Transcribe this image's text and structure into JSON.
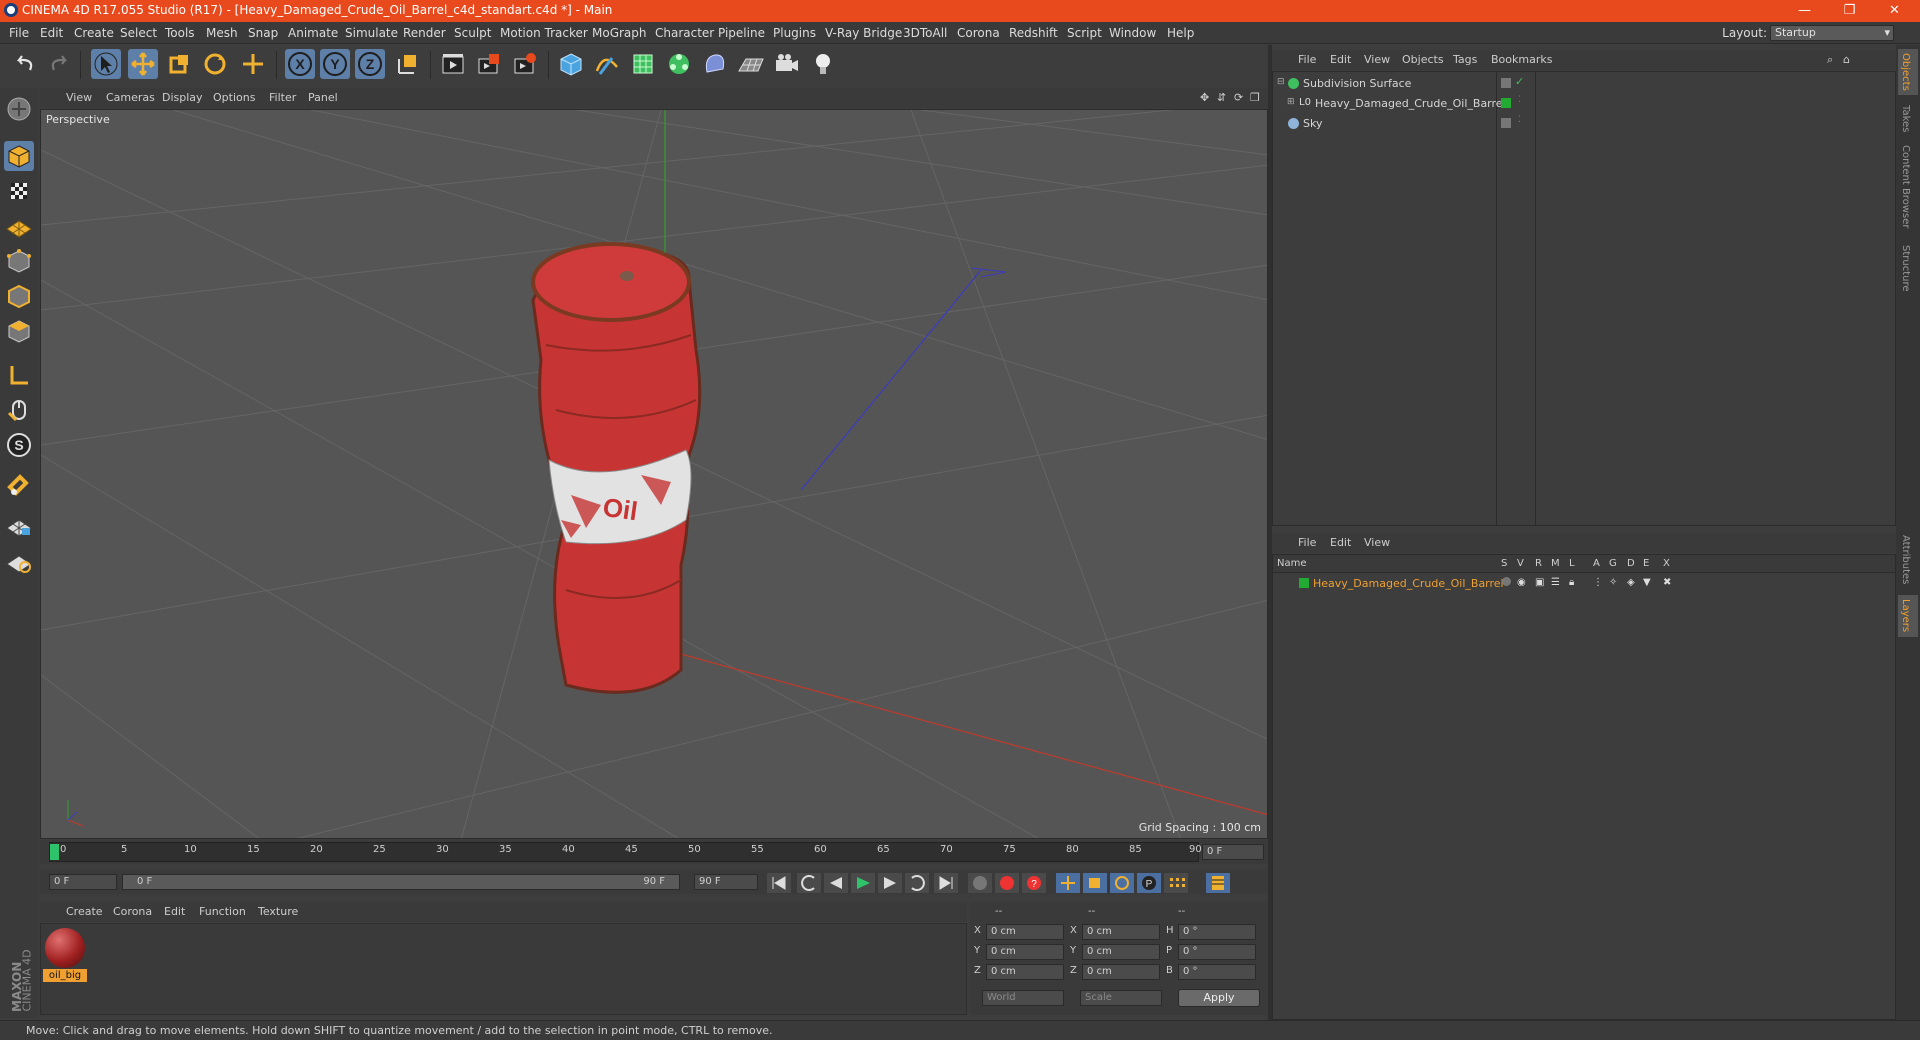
{
  "window": {
    "title": "CINEMA 4D R17.055 Studio (R17) - [Heavy_Damaged_Crude_Oil_Barrel_c4d_standart.c4d *] - Main",
    "minimize": "—",
    "maximize": "❐",
    "close": "✕"
  },
  "menubar": {
    "items": [
      "File",
      "Edit",
      "Create",
      "Select",
      "Tools",
      "Mesh",
      "Snap",
      "Animate",
      "Simulate",
      "Render",
      "Sculpt",
      "Motion Tracker",
      "MoGraph",
      "Character",
      "Pipeline",
      "Plugins",
      "V-Ray Bridge",
      "3DToAll",
      "Corona",
      "Redshift",
      "Script",
      "Window",
      "Help"
    ],
    "layout_label": "Layout:",
    "layout_value": "Startup"
  },
  "toolbar": {
    "axis_x": "X",
    "axis_y": "Y",
    "axis_z": "Z"
  },
  "viewport": {
    "menu": [
      "View",
      "Cameras",
      "Display",
      "Options",
      "Filter",
      "Panel"
    ],
    "camera_label": "Perspective",
    "grid_spacing": "Grid Spacing : 100 cm",
    "barrel_text": "Oil"
  },
  "timeline": {
    "ticks": [
      "0",
      "5",
      "10",
      "15",
      "20",
      "25",
      "30",
      "35",
      "40",
      "45",
      "50",
      "55",
      "60",
      "65",
      "70",
      "75",
      "80",
      "85",
      "90"
    ],
    "current_frame": "0 F",
    "start_field": "0 F",
    "range_start": "0 F",
    "range_end": "90 F",
    "end_field": "90 F"
  },
  "material_manager": {
    "menu": [
      "Create",
      "Corona",
      "Edit",
      "Function",
      "Texture"
    ],
    "materials": [
      {
        "name": "oil_big"
      }
    ]
  },
  "coordinates": {
    "headers": [
      "--",
      "--",
      "--"
    ],
    "rows": [
      {
        "a": "X",
        "pos": "0 cm",
        "b": "X",
        "size": "0 cm",
        "c": "H",
        "rot": "0 °"
      },
      {
        "a": "Y",
        "pos": "0 cm",
        "b": "Y",
        "size": "0 cm",
        "c": "P",
        "rot": "0 °"
      },
      {
        "a": "Z",
        "pos": "0 cm",
        "b": "Z",
        "size": "0 cm",
        "c": "B",
        "rot": "0 °"
      }
    ],
    "mode_world": "World",
    "mode_scale": "Scale",
    "apply": "Apply"
  },
  "object_manager": {
    "menu": [
      "File",
      "Edit",
      "View",
      "Objects",
      "Tags",
      "Bookmarks"
    ],
    "objects": [
      {
        "name": "Subdivision Surface"
      },
      {
        "name": "Heavy_Damaged_Crude_Oil_Barrel"
      },
      {
        "name": "Sky"
      }
    ]
  },
  "layer_manager": {
    "menu": [
      "File",
      "Edit",
      "View"
    ],
    "columns": [
      "Name",
      "S",
      "V",
      "R",
      "M",
      "L",
      "A",
      "G",
      "D",
      "E",
      "X"
    ],
    "layers": [
      {
        "name": "Heavy_Damaged_Crude_Oil_Barrel"
      }
    ]
  },
  "side_tabs": [
    "Objects",
    "Takes",
    "Content Browser",
    "Structure",
    "Attributes",
    "Layers"
  ],
  "branding": {
    "maxon": "MAXON",
    "cinema": "CINEMA 4D"
  },
  "status": "Move: Click and drag to move elements. Hold down SHIFT to quantize movement / add to the selection in point mode, CTRL to remove.",
  "colors": {
    "accent": "#e8491d",
    "selection": "#f0a030",
    "layer_green": "#22aa33",
    "barrel_red": "#d63a3a"
  }
}
